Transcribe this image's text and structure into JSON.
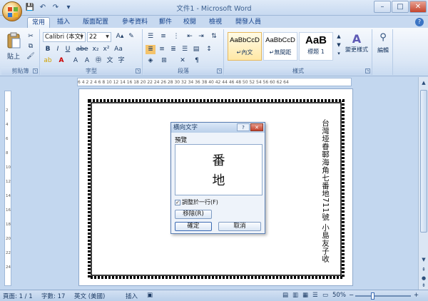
{
  "window": {
    "title": "文件1 - Microsoft Word",
    "minimize": "–",
    "maximize": "□",
    "close": "✕"
  },
  "qat": [
    "💾",
    "↶",
    "↷",
    "▾"
  ],
  "tabs": [
    "常用",
    "插入",
    "版面配置",
    "參考資料",
    "郵件",
    "校閱",
    "檢視",
    "開發人員"
  ],
  "ribbon": {
    "clipboard": {
      "paste": "貼上",
      "label": "剪貼簿"
    },
    "font": {
      "family": "Calibri (本文)",
      "size": "22",
      "label": "字型",
      "bold": "B",
      "italic": "I",
      "underline": "U",
      "strike": "abe",
      "sub": "x₂",
      "sup": "x²",
      "aa": "Aa"
    },
    "paragraph": {
      "label": "段落"
    },
    "styles": {
      "label": "樣式",
      "items": [
        {
          "sample": "AaBbCcD",
          "name": "↵內文"
        },
        {
          "sample": "AaBbCcD",
          "name": "↵無間距"
        },
        {
          "sample": "AaB",
          "name": "標題 1"
        }
      ],
      "change": "變更樣式"
    },
    "editing": {
      "label": "編輯"
    }
  },
  "ruler": "6  4  2     2  4  6  8  10  12  14  16  18  20  22  24  26  28  30  32  34  36  38  40  42  44  46  48  50  52  54  56     60  62  64",
  "vruler": [
    "2",
    "4",
    "6",
    "8",
    "10",
    "12",
    "14",
    "16",
    "18",
    "20",
    "22",
    "24"
  ],
  "document": {
    "vertical_text": "台灣垭眷鄆海角七番地711號 小島友子收"
  },
  "dialog": {
    "title": "橫向文字",
    "help": "?",
    "close": "✕",
    "preview_label": "預覽",
    "preview_chars": [
      "番",
      "地"
    ],
    "fit_line": "調整於一行(F)",
    "fit_checked": "✓",
    "remove": "移除(R)",
    "ok": "確定",
    "cancel": "取消"
  },
  "status": {
    "page": "頁面: 1 / 1",
    "words": "字數: 17",
    "lang": "英文 (美國)",
    "mode": "插入",
    "zoom": "50%",
    "zoom_minus": "−",
    "zoom_plus": "+"
  }
}
